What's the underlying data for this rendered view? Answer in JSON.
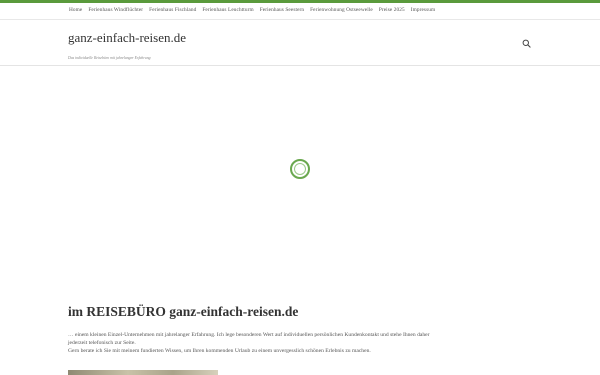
{
  "topnav": {
    "items": [
      {
        "label": "Home"
      },
      {
        "label": "Ferienhaus Windflüchter"
      },
      {
        "label": "Ferienhaus Fischland"
      },
      {
        "label": "Ferienhaus Leuchtturm"
      },
      {
        "label": "Ferienhaus Seestern"
      },
      {
        "label": "Ferienwohnung Ostseewelle"
      },
      {
        "label": "Preise 2025"
      },
      {
        "label": "Impressum"
      }
    ]
  },
  "header": {
    "site_title": "ganz-einfach-reisen.de",
    "tagline": "Das individuelle Reisebüro mit jahrelanger Erfahrung",
    "search_icon": "search-icon"
  },
  "hero": {
    "loading_icon": "loading-spinner-icon",
    "accent_color": "#6aa84f"
  },
  "main": {
    "heading": "im REISEBÜRO ganz-einfach-reisen.de",
    "intro_lines": [
      "… einem kleinen Einzel-Unternehmen mit jahrelanger Erfahrung. Ich lege besonderen Wert auf individuellen persönlichen Kundenkontakt und stehe Ihnen daher",
      "jederzeit telefonisch zur Seite.",
      "Gern berate ich Sie mit meinem fundierten Wissen, um Ihren kommenden Urlaub zu einem unvergesslich schönen Erlebnis zu machen."
    ]
  },
  "colors": {
    "brand_green": "#5a9a3c"
  }
}
